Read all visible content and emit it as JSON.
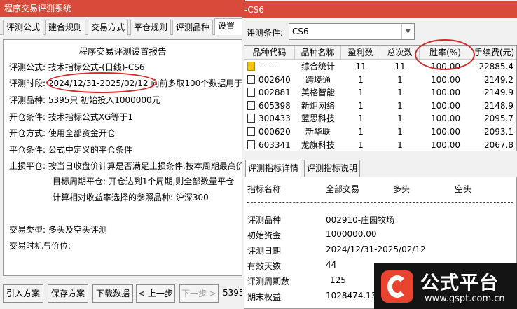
{
  "left_window": {
    "title": "程序交易评测系统",
    "tabs": [
      "评测公式",
      "建合规则",
      "交易方式",
      "平仓规则",
      "评测品种",
      "设置报"
    ],
    "report": {
      "title": "程序交易评测设置报告",
      "lines": [
        {
          "label": "评测公式:",
          "value": "技术指标公式-(日线)-CS6"
        },
        {
          "label": "评测时段:",
          "value": "2024/12/31-2025/02/12 向前多取100个数据用于"
        },
        {
          "label": "评测品种:",
          "value": "5395只 初始投入1000000元"
        },
        {
          "label": "开仓条件:",
          "value": "技术指标公式XG等于1"
        },
        {
          "label": "开仓方式:",
          "value": "使用全部资金开仓"
        },
        {
          "label": "平仓条件:",
          "value": "公式中定义的平仓条件"
        },
        {
          "label": "止损平仓:",
          "value": "按当日收盘价计算是否满足止损条件,按本周期最高价"
        }
      ],
      "target_line": "目标周期平仓: 开仓达到1个周期,则全部数量平仓",
      "benchmark_line": "计算相对收益率选择的参照品种: 沪深300",
      "trade_type": {
        "label": "交易类型:",
        "value": "多头及空头评测"
      },
      "trade_timing": {
        "label": "交易时机与价位:",
        "value": ""
      }
    },
    "buttons": {
      "import": "引入方案",
      "save": "保存方案",
      "download": "下载数据",
      "prev": "< 上一步",
      "next": "下一步 >",
      "trailing_text": "5395"
    }
  },
  "right_window": {
    "title": "-CS6",
    "condition_label": "评测条件:",
    "condition_value": "CS6",
    "grid_headers": [
      "品种代码",
      "品种名称",
      "盈利数",
      "总次数",
      "胜率(%)",
      "手续费(元)"
    ],
    "grid_rows": [
      {
        "code": "------",
        "name": "综合统计",
        "profit": "11",
        "total": "11",
        "rate": "100.00",
        "fee": "22885.4"
      },
      {
        "code": "002640",
        "name": "跨境通",
        "profit": "1",
        "total": "1",
        "rate": "100.00",
        "fee": "2149.2"
      },
      {
        "code": "002881",
        "name": "美格智能",
        "profit": "1",
        "total": "1",
        "rate": "100.00",
        "fee": "2149.9"
      },
      {
        "code": "605398",
        "name": "新炬网络",
        "profit": "1",
        "total": "1",
        "rate": "100.00",
        "fee": "2148.9"
      },
      {
        "code": "300433",
        "name": "蓝思科技",
        "profit": "1",
        "total": "1",
        "rate": "100.00",
        "fee": "2095.7"
      },
      {
        "code": "000620",
        "name": "新华联",
        "profit": "1",
        "total": "1",
        "rate": "100.00",
        "fee": "2093.1"
      },
      {
        "code": "603341",
        "name": "龙旗科技",
        "profit": "1",
        "total": "1",
        "rate": "100.00",
        "fee": "2067.8"
      }
    ],
    "sub_tabs": [
      "评测指标详情",
      "评测指标说明"
    ],
    "detail_headers": [
      "指标名称",
      "全部交易",
      "多头",
      "空头"
    ],
    "detail_rows": [
      {
        "name": "评测品种",
        "value": "002910-庄园牧场"
      },
      {
        "name": "初始资金",
        "value": "1000000.00"
      },
      {
        "name": "评测日期",
        "value": "2024/12/31-2025/02/12"
      },
      {
        "name": "有效天数",
        "value": "44"
      },
      {
        "name": "评测周期数",
        "value": "125"
      },
      {
        "name": "期末权益",
        "value": "1028474.13"
      }
    ]
  },
  "watermark": {
    "name": "公式平台",
    "url": "www.gspt.com.cn"
  },
  "colors": {
    "title_bar": "#d84a3a",
    "annotation": "#d62a2a"
  }
}
